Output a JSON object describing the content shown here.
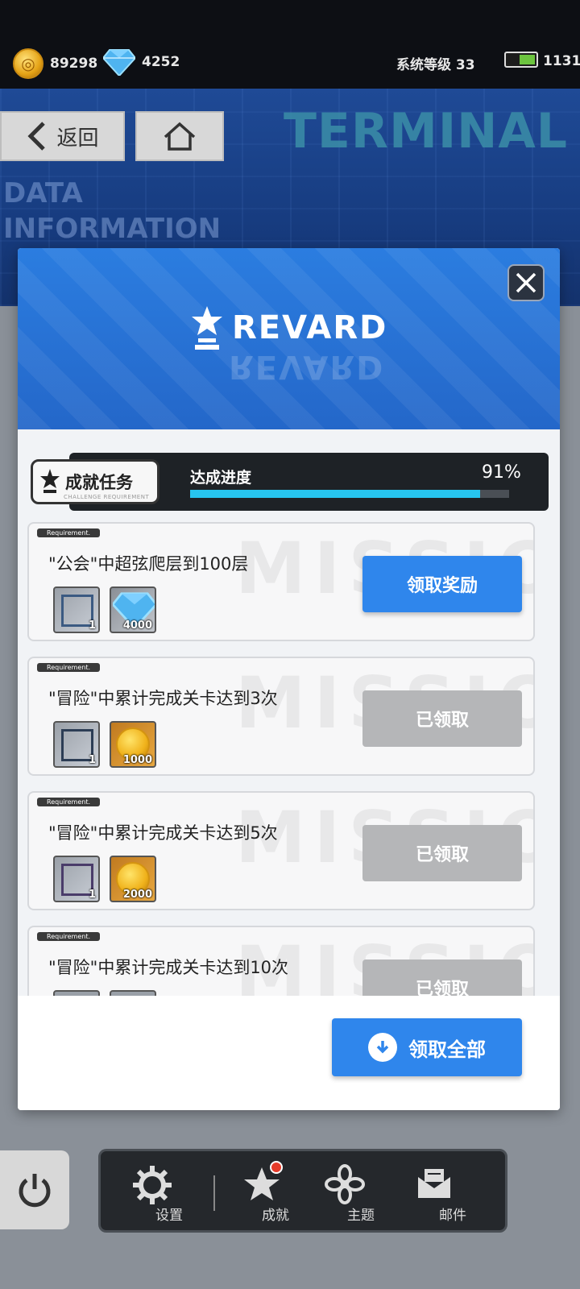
{
  "topbar": {
    "gold": "89298",
    "gems": "4252",
    "system_level": "系统等级 33",
    "battery_value": "1131",
    "battery_level": 0.55,
    "icons": [
      "coin-icon",
      "gem-icon",
      "battery-icon"
    ]
  },
  "banner": {
    "title": "TERMINAL",
    "subtitle_line1": "DATA",
    "subtitle_line2": "INFORMATION",
    "back_label": "返回"
  },
  "modal": {
    "title": "REVARD",
    "progress": {
      "tag": "成就任务",
      "tag_sub": "CHALLENGE REQUIREMENT",
      "label": "达成进度",
      "percent_text": "91%",
      "value": 0.91
    },
    "watermark": "MISSIO",
    "requirement_tag": "Requirement.",
    "missions": [
      {
        "desc": "\"公会\"中超弦爬层到100层",
        "rewards": [
          {
            "type": "frame",
            "qty": "1"
          },
          {
            "type": "gem",
            "qty": "4000"
          }
        ],
        "button": "领取奖励",
        "state": "active"
      },
      {
        "desc": "\"冒险\"中累计完成关卡达到3次",
        "rewards": [
          {
            "type": "frame",
            "qty": "1"
          },
          {
            "type": "coin",
            "qty": "1000"
          }
        ],
        "button": "已领取",
        "state": "claimed"
      },
      {
        "desc": "\"冒险\"中累计完成关卡达到5次",
        "rewards": [
          {
            "type": "frame",
            "qty": "1"
          },
          {
            "type": "coin",
            "qty": "2000"
          }
        ],
        "button": "已领取",
        "state": "claimed"
      },
      {
        "desc": "\"冒险\"中累计完成关卡达到10次",
        "rewards": [],
        "button": "已领取",
        "state": "claimed"
      }
    ],
    "claim_all": "领取全部"
  },
  "dock": {
    "items": [
      {
        "label": "设置",
        "icon": "gear-icon"
      },
      {
        "label": "成就",
        "icon": "star-icon",
        "badge": true
      },
      {
        "label": "主题",
        "icon": "flower-icon"
      },
      {
        "label": "邮件",
        "icon": "mail-icon"
      }
    ]
  },
  "colors": {
    "accent": "#2f86ec",
    "progress_fill": "#27c5ef",
    "claimed": "#b5b6b8",
    "header_blue": "#2b7de0"
  }
}
